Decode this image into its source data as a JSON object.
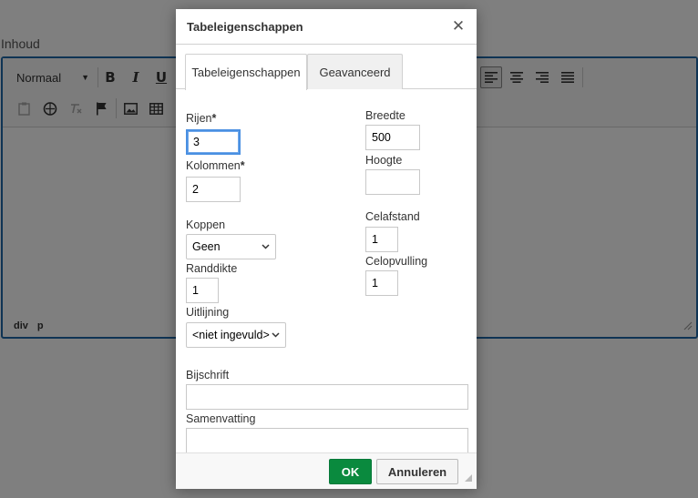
{
  "page": {
    "field_label": "Inhoud"
  },
  "editor": {
    "format_select": "Normaal",
    "toolbar_row1": [
      "bold-icon",
      "italic-icon",
      "underline-icon",
      "align-left-icon",
      "align-center-icon",
      "align-right-icon",
      "align-justify-icon"
    ],
    "toolbar_row2": [
      "paste-text-icon",
      "paste-word-icon",
      "remove-format-icon",
      "anchor-flag-icon",
      "image-icon",
      "table-icon"
    ],
    "bold_label": "B",
    "italic_label": "I",
    "underline_label": "U",
    "status_path": [
      "div",
      "p"
    ]
  },
  "dialog": {
    "title": "Tabeleigenschappen",
    "close_icon": "close-icon",
    "tabs": [
      {
        "label": "Tabeleigenschappen",
        "active": true
      },
      {
        "label": "Geavanceerd",
        "active": false
      }
    ],
    "fields": {
      "rows": {
        "label": "Rijen",
        "required_mark": "*",
        "value": "3"
      },
      "columns": {
        "label": "Kolommen",
        "required_mark": "*",
        "value": "2"
      },
      "headers": {
        "label": "Koppen",
        "value": "Geen"
      },
      "border": {
        "label": "Randdikte",
        "value": "1"
      },
      "alignment": {
        "label": "Uitlijning",
        "value": "<niet ingevuld>"
      },
      "width": {
        "label": "Breedte",
        "value": "500"
      },
      "height": {
        "label": "Hoogte",
        "value": ""
      },
      "cellspacing": {
        "label": "Celafstand",
        "value": "1"
      },
      "cellpadding": {
        "label": "Celopvulling",
        "value": "1"
      },
      "caption": {
        "label": "Bijschrift",
        "value": ""
      },
      "summary": {
        "label": "Samenvatting",
        "value": ""
      }
    },
    "buttons": {
      "ok": "OK",
      "cancel": "Annuleren"
    }
  },
  "colors": {
    "editor_border": "#1e68a8",
    "ok_button": "#0a8a3e",
    "focus_ring": "#4a90e2",
    "overlay": "rgba(0,0,0,0.5)"
  }
}
